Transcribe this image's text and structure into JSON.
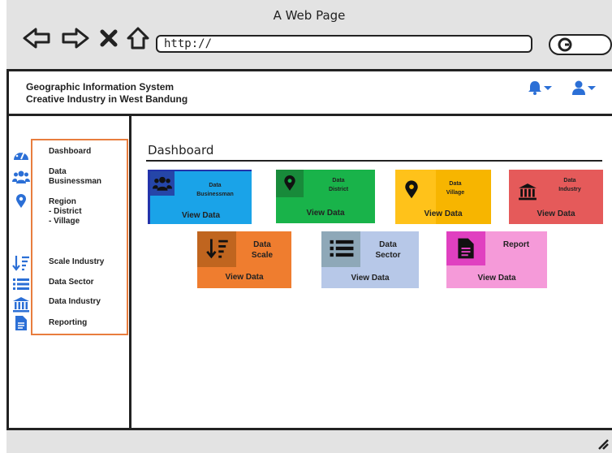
{
  "window": {
    "title": "A Web Page",
    "url": "http://"
  },
  "header": {
    "title_line1": "Geographic Information System",
    "title_line2": "Creative Industry in West Bandung"
  },
  "sidebar": {
    "items": [
      {
        "label": "Dashboard"
      },
      {
        "label": "Data\nBusinessman"
      },
      {
        "label": "Region\n- District\n- Village"
      },
      {
        "label": "Scale Industry"
      },
      {
        "label": "Data Sector"
      },
      {
        "label": "Data Industry"
      },
      {
        "label": "Reporting"
      }
    ]
  },
  "main": {
    "title": "Dashboard",
    "cards": [
      {
        "label": "Data\nBusinessman",
        "action": "View Data",
        "color": "#1aa3e8",
        "icon": "users-icon"
      },
      {
        "label": "Data\nDistrict",
        "action": "View Data",
        "color": "#19b34a",
        "icon": "map-pin-icon"
      },
      {
        "label": "Data\nVillage",
        "action": "View Data",
        "color": "#f7b500",
        "icon": "map-pin-icon"
      },
      {
        "label": "Data\nIndustry",
        "action": "View Data",
        "color": "#e55a5a",
        "icon": "bank-icon"
      },
      {
        "label": "Data\nScale",
        "action": "View Data",
        "color": "#ef7d2f",
        "icon": "sort-icon"
      },
      {
        "label": "Data\nSector",
        "action": "View Data",
        "color": "#b7c8e8",
        "icon": "list-icon"
      },
      {
        "label": "Report",
        "action": "View Data",
        "color": "#f59ad9",
        "icon": "file-icon"
      }
    ]
  }
}
